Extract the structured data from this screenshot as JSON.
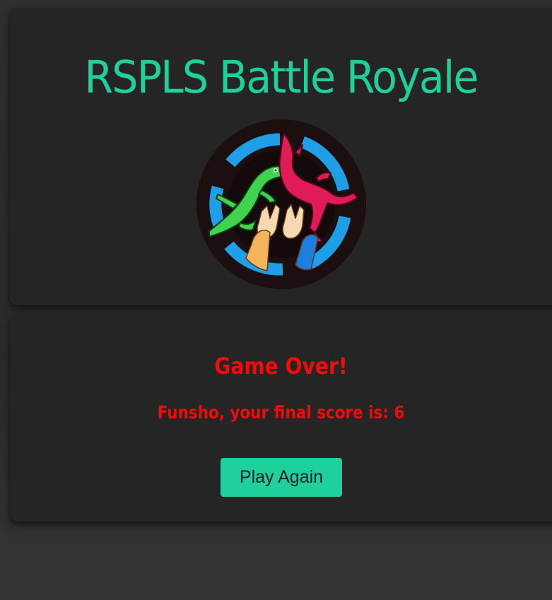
{
  "header": {
    "title": "RSPLS Battle Royale",
    "logo_icon": "rock-paper-scissors-lizard-spock-logo-icon"
  },
  "result": {
    "heading": "Game Over!",
    "score_text": "Funsho, your final score is: 6",
    "play_again_label": "Play Again"
  },
  "colors": {
    "accent": "#1fcf9c",
    "alert": "#f30b0b",
    "card": "#252525",
    "background": "#2f2f2f"
  }
}
